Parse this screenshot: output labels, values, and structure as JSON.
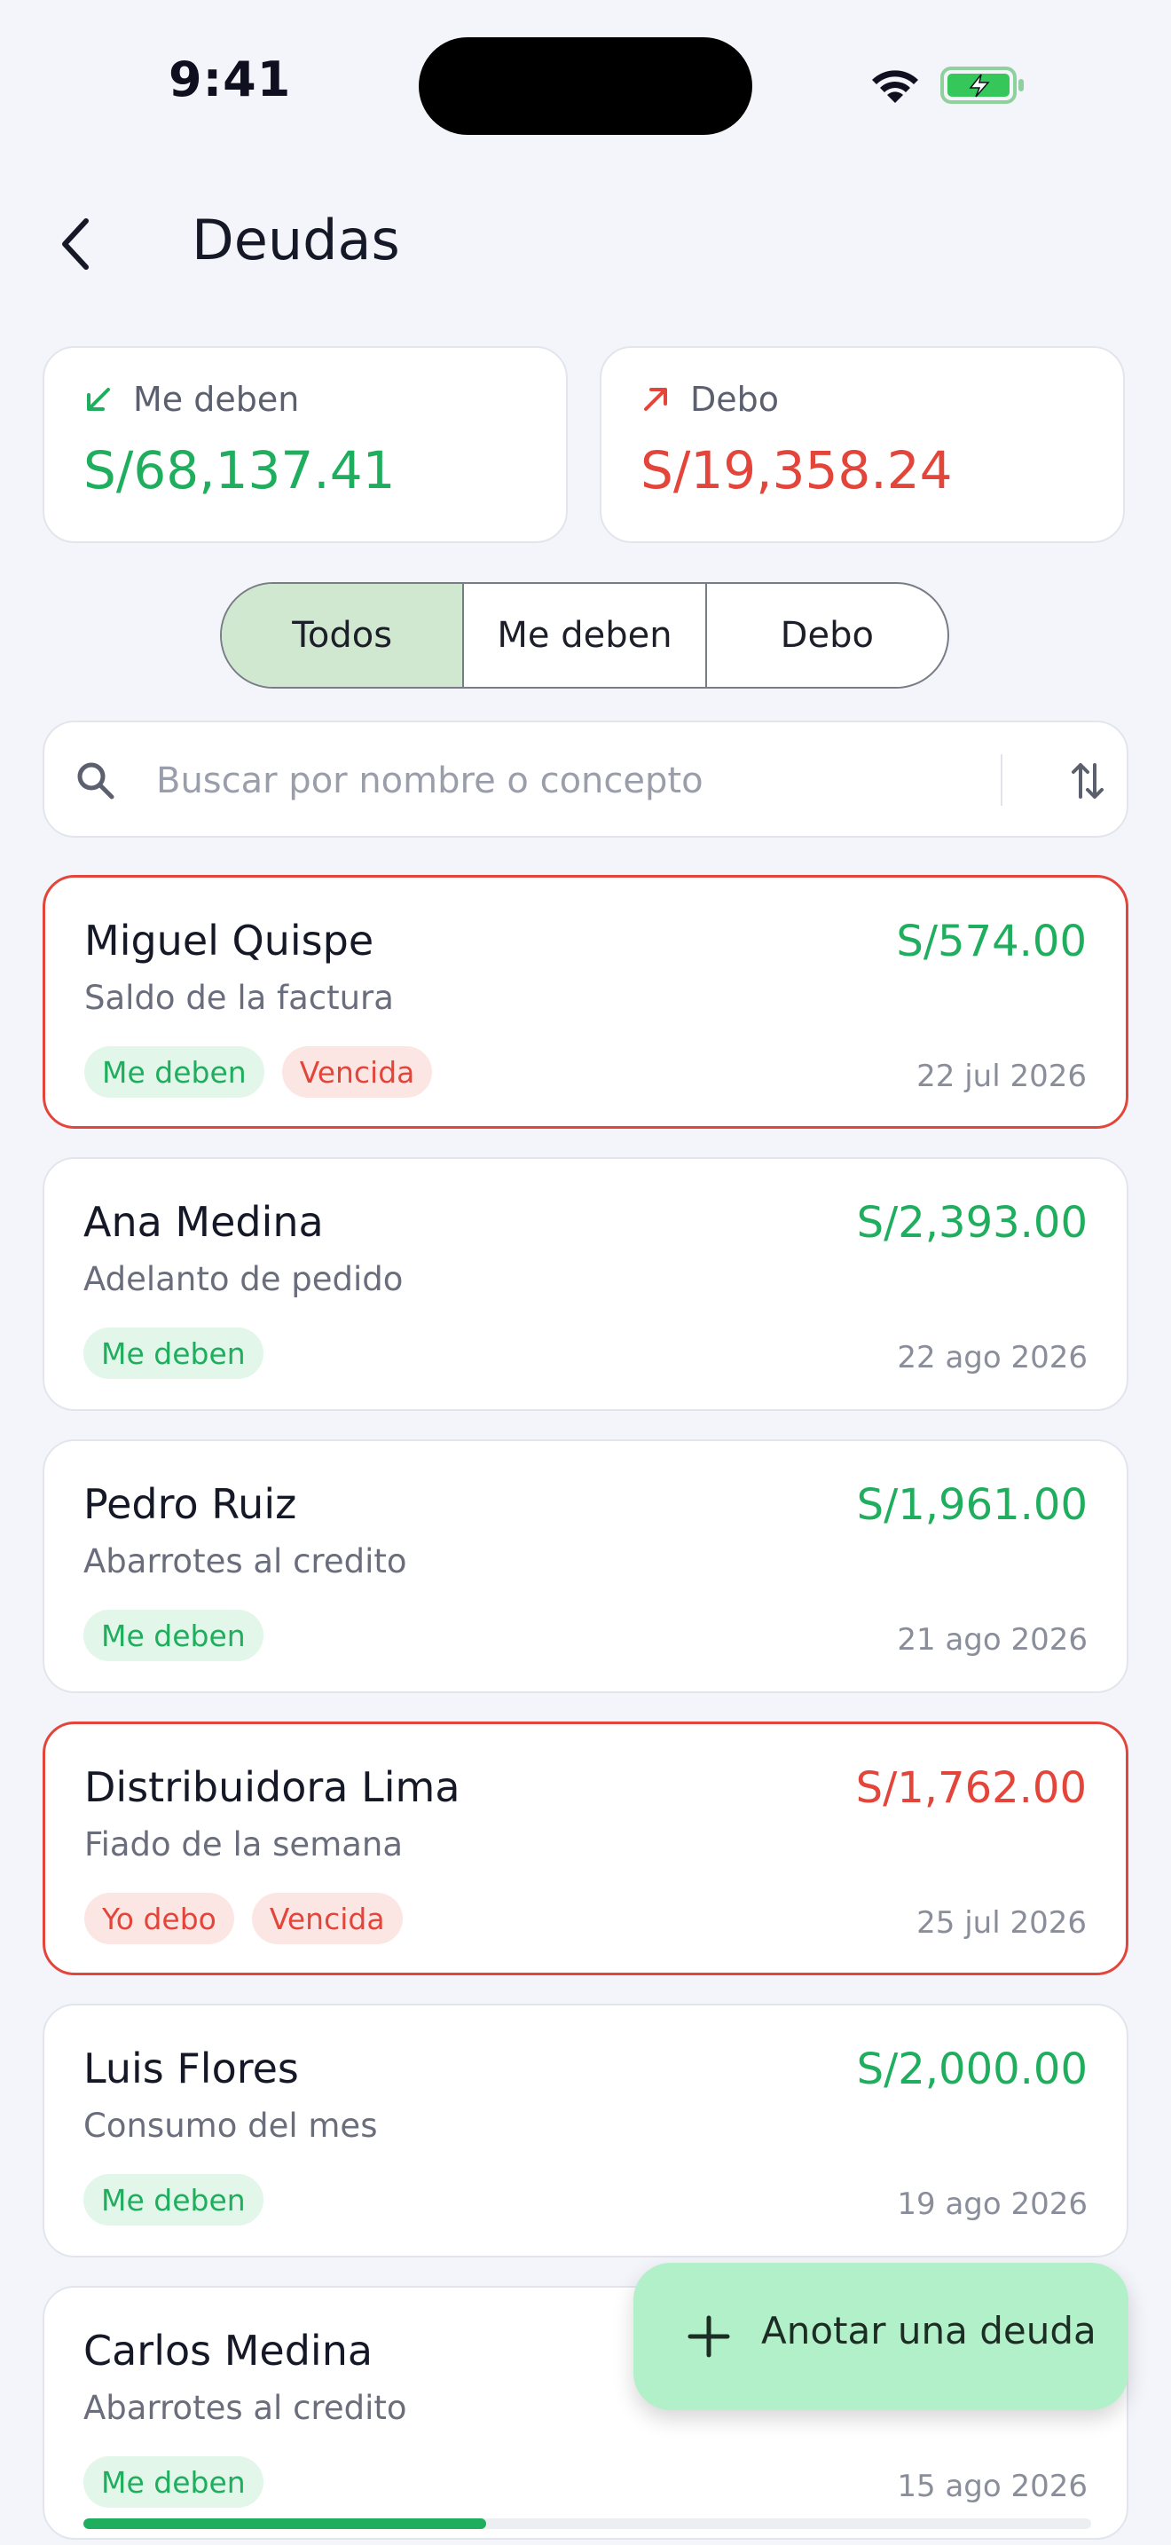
{
  "status_bar": {
    "time": "9:41"
  },
  "header": {
    "title": "Deudas"
  },
  "summary": {
    "owed_to_me": {
      "label": "Me deben",
      "value": "S/68,137.41",
      "color": "#1FAE5E",
      "icon": "arrow-down-left-icon"
    },
    "i_owe": {
      "label": "Debo",
      "value": "S/19,358.24",
      "color": "#E3453A",
      "icon": "arrow-up-right-icon"
    }
  },
  "filter_tabs": [
    {
      "label": "Todos",
      "active": true
    },
    {
      "label": "Me deben",
      "active": false
    },
    {
      "label": "Debo",
      "active": false
    }
  ],
  "search": {
    "placeholder": "Buscar por nombre o concepto",
    "value": ""
  },
  "debts": [
    {
      "name": "Miguel Quispe",
      "concept": "Saldo de la factura",
      "amount": "S/574.00",
      "direction": "Me deben",
      "status": "Vencida",
      "date": "22 jul 2026"
    },
    {
      "name": "Ana Medina",
      "concept": "Adelanto de pedido",
      "amount": "S/2,393.00",
      "direction": "Me deben",
      "status": "",
      "date": "22 ago 2026"
    },
    {
      "name": "Pedro Ruiz",
      "concept": "Abarrotes al credito",
      "amount": "S/1,961.00",
      "direction": "Me deben",
      "status": "",
      "date": "21 ago 2026"
    },
    {
      "name": "Distribuidora Lima",
      "concept": "Fiado de la semana",
      "amount": "S/1,762.00",
      "direction": "Yo debo",
      "status": "Vencida",
      "date": "25 jul 2026"
    },
    {
      "name": "Luis Flores",
      "concept": "Consumo del mes",
      "amount": "S/2,000.00",
      "direction": "Me deben",
      "status": "",
      "date": "19 ago 2026"
    },
    {
      "name": "Carlos Medina",
      "concept": "Abarrotes al credito",
      "amount": "",
      "direction": "Me deben",
      "status": "",
      "date": "15 ago 2026",
      "progress": 0.4
    }
  ],
  "fab": {
    "label": "Anotar una deuda",
    "icon": "plus-icon"
  }
}
